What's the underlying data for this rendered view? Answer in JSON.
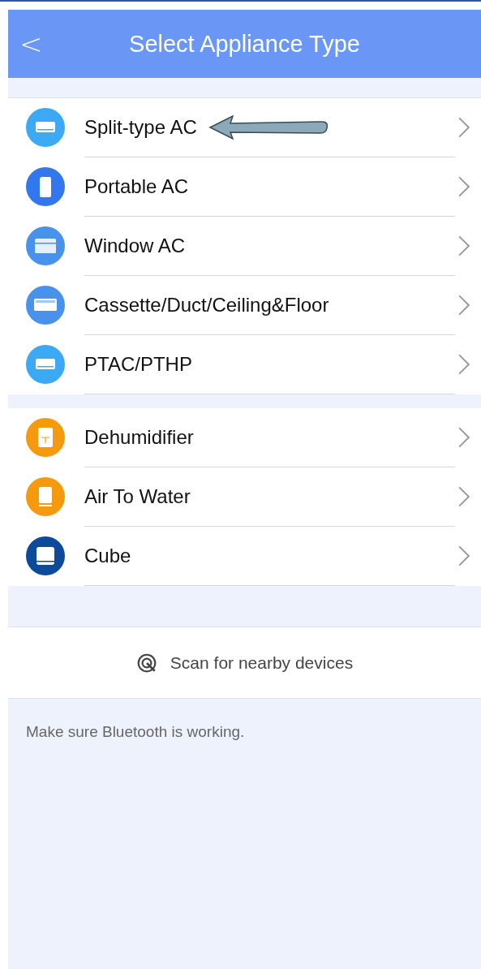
{
  "header": {
    "back": "<",
    "title": "Select Appliance Type"
  },
  "groups": [
    {
      "items": [
        {
          "label": "Split-type AC",
          "kind": "split",
          "color": "#3ca9f4"
        },
        {
          "label": "Portable AC",
          "kind": "portable",
          "color": "#3377ee"
        },
        {
          "label": "Window AC",
          "kind": "window",
          "color": "#4892ec"
        },
        {
          "label": "Cassette/Duct/Ceiling&Floor",
          "kind": "cassette",
          "color": "#4892ec"
        },
        {
          "label": "PTAC/PTHP",
          "kind": "split",
          "color": "#3ca9f4"
        }
      ]
    },
    {
      "items": [
        {
          "label": "Dehumidifier",
          "kind": "dehumidifier",
          "color": "#f5990e"
        },
        {
          "label": "Air To Water",
          "kind": "airtowater",
          "color": "#f5990e"
        },
        {
          "label": "Cube",
          "kind": "cube",
          "color": "#0e4a9a"
        }
      ]
    }
  ],
  "scan": {
    "label": "Scan for nearby devices"
  },
  "hint": "Make sure Bluetooth is working."
}
